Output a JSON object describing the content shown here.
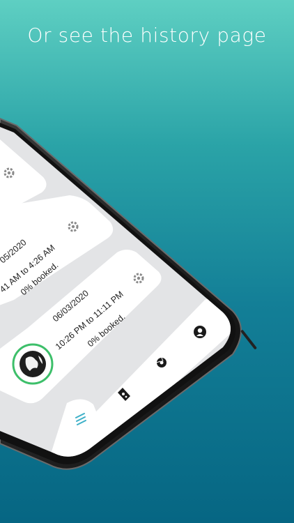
{
  "promo": {
    "headline": "Or see the history page"
  },
  "cards": [
    {
      "date": "",
      "time": "",
      "status": ""
    },
    {
      "date": "05/2020",
      "time": "41 AM to 4:26 AM",
      "status": "0% booked."
    },
    {
      "date": "06/03/2020",
      "time": "10:26 PM to 11:11 PM",
      "status": "0% booked."
    }
  ],
  "icons": {
    "settings": "gear-icon",
    "fab": "globe-icon",
    "nav_history": "list-icon",
    "nav_map": "map-icon",
    "nav_camera": "aperture-icon",
    "nav_profile": "profile-icon"
  },
  "colors": {
    "accent": "#3dbf6a",
    "nav_active": "#3db0c8",
    "bg_top": "#5ecfc2",
    "bg_bottom": "#066683"
  }
}
